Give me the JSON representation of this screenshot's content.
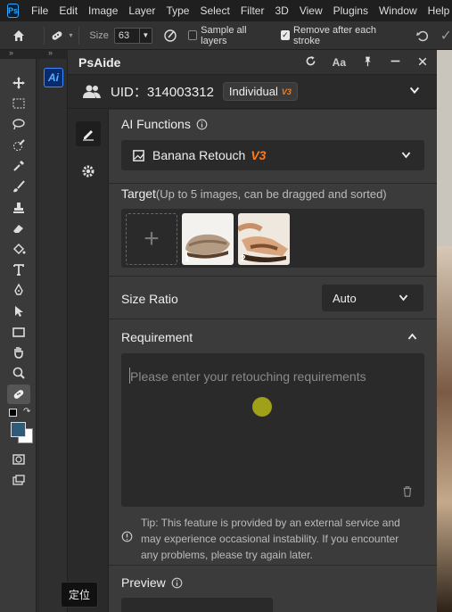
{
  "menubar": {
    "logo": "Ps",
    "items": [
      "File",
      "Edit",
      "Image",
      "Layer",
      "Type",
      "Select",
      "Filter",
      "3D",
      "View",
      "Plugins",
      "Window",
      "Help"
    ]
  },
  "options": {
    "size_label": "Size",
    "size_value": "63",
    "sample_all_layers": "Sample all layers",
    "remove_after_stroke": "Remove after each stroke"
  },
  "tooltip": "定位",
  "panel": {
    "title": "PsAide",
    "uid": "UID：314003312",
    "plan": "Individual",
    "plan_version": "V3",
    "ai_functions": {
      "label": "AI Functions",
      "selected": "Banana Retouch",
      "selected_version": "V3"
    },
    "target": {
      "label": "Target",
      "hint": "(Up to 5 images, can be dragged and sorted)",
      "images": [
        {
          "index": "1",
          "alt": "sandal-photo"
        },
        {
          "index": "2",
          "alt": "sandal-on-foot-photo"
        }
      ]
    },
    "size_ratio": {
      "label": "Size Ratio",
      "selected": "Auto"
    },
    "requirement": {
      "label": "Requirement",
      "placeholder": "Please enter your retouching requirements"
    },
    "tip": "Tip: This feature is provided by an external service and may experience occasional instability. If you encounter any problems, please try again later.",
    "preview": {
      "label": "Preview"
    }
  },
  "colors": {
    "accent_orange": "#ff7a18",
    "ps_blue": "#31a8ff",
    "panel_bg": "#3b3b3b"
  }
}
